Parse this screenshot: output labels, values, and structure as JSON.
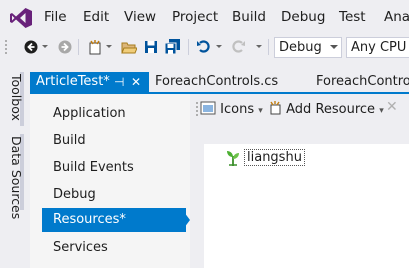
{
  "menu": {
    "items": [
      "File",
      "Edit",
      "View",
      "Project",
      "Build",
      "Debug",
      "Test",
      "Anal"
    ]
  },
  "toolbar": {
    "config_combo": "Debug",
    "platform_combo": "Any CPU"
  },
  "side_strip": {
    "toolbox": "Toolbox",
    "data_sources": "Data Sources"
  },
  "tabs": [
    {
      "label": "ArticleTest*",
      "active": true
    },
    {
      "label": "ForeachControls.cs",
      "active": false
    },
    {
      "label": "ForeachControls",
      "active": false
    }
  ],
  "project_nav": {
    "items": [
      "Application",
      "Build",
      "Build Events",
      "Debug",
      "Resources*",
      "Services"
    ],
    "selected": "Resources*"
  },
  "resource_toolbar": {
    "category": "Icons",
    "add_resource": "Add Resource"
  },
  "resources": [
    {
      "name": "liangshu",
      "icon": "plant-icon"
    }
  ],
  "colors": {
    "accent": "#007acc",
    "background": "#eeeef2",
    "nav_bg": "#f5f5f5",
    "vs_logo": "#68217a"
  }
}
